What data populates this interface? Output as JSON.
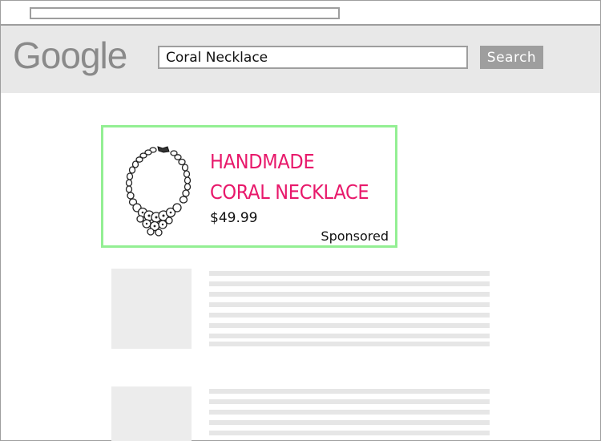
{
  "header": {
    "logo_text": "Google",
    "search_value": "Coral Necklace",
    "search_button_label": "Search"
  },
  "ad": {
    "title": "HANDMADE\nCORAL NECKLACE",
    "price": "$49.99",
    "sponsored_label": "Sponsored"
  },
  "colors": {
    "ad_title": "#e8196b",
    "ad_border": "#93ef93",
    "header_bg": "#e8e8e8",
    "placeholder": "#e6e6e6"
  },
  "icons": {
    "product_image": "necklace-illustration"
  }
}
